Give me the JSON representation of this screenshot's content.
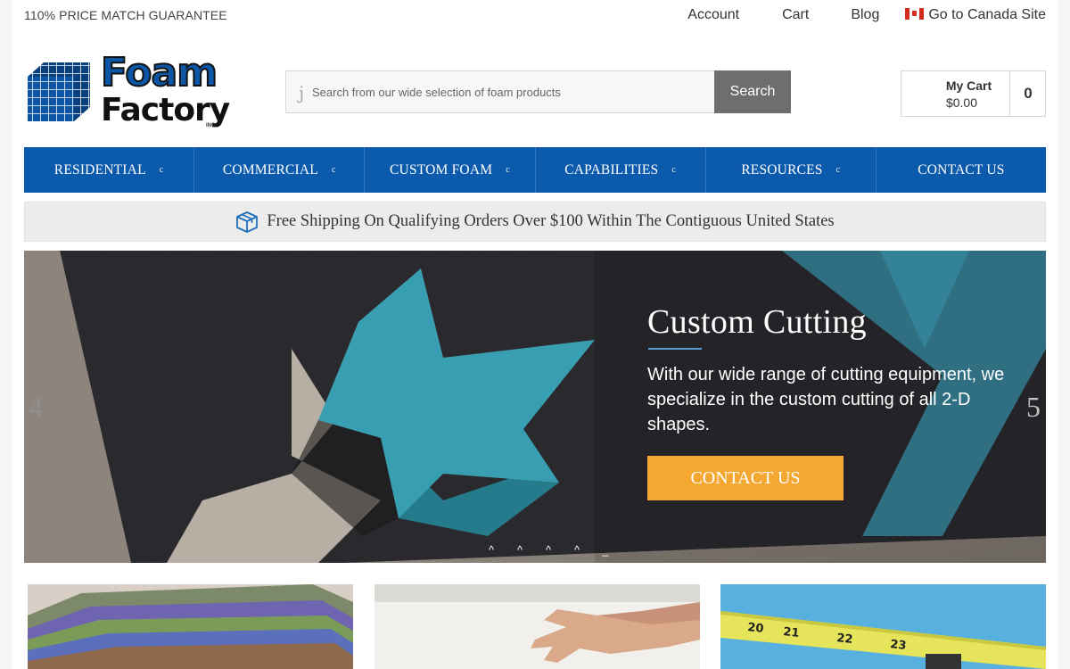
{
  "topbar": {
    "promo": "110% PRICE MATCH GUARANTEE",
    "account": "Account",
    "cart": "Cart",
    "blog": "Blog",
    "canada": "Go to Canada Site"
  },
  "logo": {
    "line1": "Foam",
    "line2": "Factory",
    "inc": "INC."
  },
  "search": {
    "icon_glyph": "j",
    "placeholder": "Search from our wide selection of foam products",
    "button": "Search"
  },
  "minicart": {
    "label": "My Cart",
    "total": "$0.00",
    "count": "0"
  },
  "nav": {
    "chevron": "c",
    "items": [
      {
        "label": "RESIDENTIAL"
      },
      {
        "label": "COMMERCIAL"
      },
      {
        "label": "CUSTOM FOAM"
      },
      {
        "label": "CAPABILITIES"
      },
      {
        "label": "RESOURCES"
      },
      {
        "label": "CONTACT US"
      }
    ]
  },
  "shipping": {
    "text": "Free Shipping On Qualifying Orders Over $100 Within The Contiguous United States"
  },
  "hero": {
    "title": "Custom Cutting",
    "subtitle": "With our wide range of cutting equipment, we specialize in the custom cutting of all 2-D shapes.",
    "cta": "CONTACT US",
    "prev_glyph": "4",
    "next_glyph": "5",
    "dots": [
      "^",
      "^",
      "^",
      "^",
      "_"
    ]
  },
  "colors": {
    "nav_blue": "#0c5aac",
    "cta_orange": "#f4a731",
    "search_button": "#6c6e70",
    "hero_accent": "#5b9bd5"
  },
  "icons": [
    "logo-cube-icon",
    "search-icon",
    "canada-flag-icon",
    "box-icon",
    "chevron-down-icon"
  ]
}
